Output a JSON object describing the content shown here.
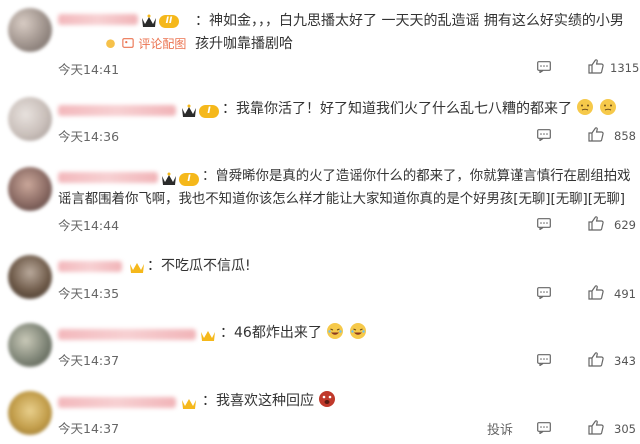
{
  "comments": [
    {
      "text": "：神如金，，，白九思播太好了 一天天的乱造谣 拥有这么好实绩的小男孩升咖靠播剧哈",
      "link": "评论配图",
      "time": "今天14:41",
      "likes": "1315",
      "level": "II"
    },
    {
      "text": "：我靠你活了！好了知道我们火了什么乱七八糟的都来了",
      "time": "今天14:36",
      "likes": "858",
      "level": "I"
    },
    {
      "text": "：曾舜晞你是真的火了造谣你什么的都来了，你就算谨言慎行在剧组拍戏谣言都围着你飞啊，我也不知道你该怎么样才能让大家知道你真的是个好男孩[无聊][无聊][无聊]",
      "time": "今天14:44",
      "likes": "629",
      "level": "I"
    },
    {
      "text": "：不吃瓜不信瓜!",
      "time": "今天14:35",
      "likes": "491"
    },
    {
      "text": "：46都炸出来了",
      "time": "今天14:37",
      "likes": "343"
    },
    {
      "text": "：我喜欢这种回应",
      "time": "今天14:37",
      "likes": "305"
    }
  ],
  "footer": {
    "report": "投诉"
  },
  "colors": {
    "link": "#eb7350",
    "badge": "#f5b81b",
    "name_blur": "#f3b8bc"
  },
  "icons": {
    "reply": "comment-icon",
    "like": "thumbs-up-icon",
    "crown": "crown-icon"
  }
}
